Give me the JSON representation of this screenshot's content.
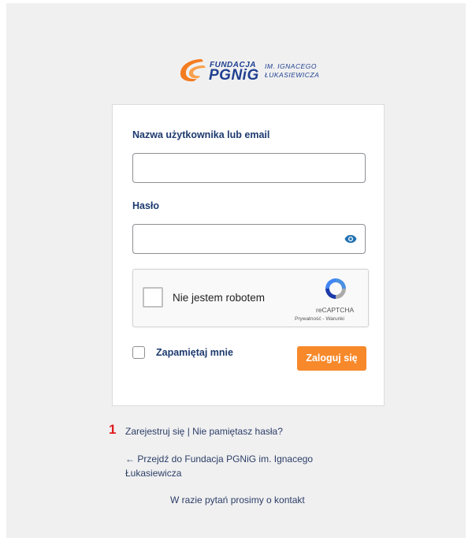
{
  "logo": {
    "line1": "FUNDACJA",
    "line2": "PGNiG",
    "line3": "IM. IGNACEGO",
    "line4": "ŁUKASIEWICZA"
  },
  "form": {
    "username_label": "Nazwa użytkownika lub email",
    "username_value": "",
    "password_label": "Hasło",
    "password_value": "",
    "show_password_icon": "eye-icon",
    "captcha": {
      "label": "Nie jestem robotem",
      "brand": "reCAPTCHA",
      "links": "Prywatność - Warunki"
    },
    "remember_label": "Zapamiętaj mnie",
    "login_button": "Zaloguj się"
  },
  "annotation_number": "1",
  "nav": {
    "register": "Zarejestruj się",
    "separator": "|",
    "lost_password": "Nie pamiętasz hasła?",
    "back_link": "← Przejdź do Fundacja PGNiG im. Ignacego Łukasiewicza",
    "contact": "W razie pytań prosimy o kontakt"
  },
  "colors": {
    "accent": "#f7892b",
    "brand_blue": "#1e3f8f",
    "label_blue": "#1d3a6e",
    "background": "#f0f0f1"
  }
}
